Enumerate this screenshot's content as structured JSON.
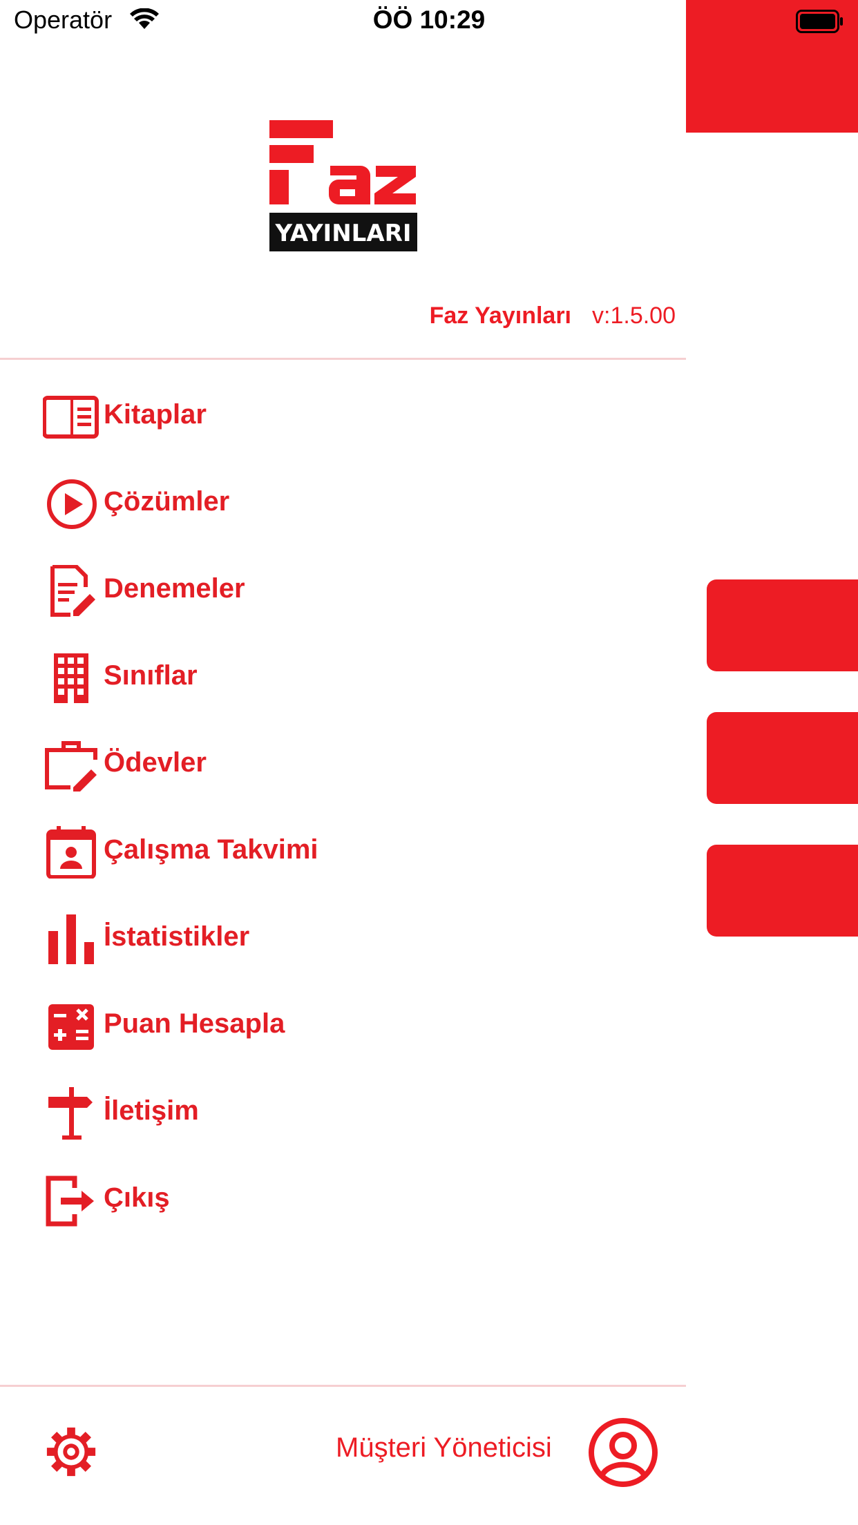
{
  "status_bar": {
    "carrier": "Operatör",
    "time": "ÖÖ 10:29"
  },
  "colors": {
    "accent": "#ed1c24",
    "logo_dark": "#111111",
    "divider": "#f6cfd1"
  },
  "logo": {
    "text": "YAYINLARI"
  },
  "drawer": {
    "brand_name": "Faz Yayınları",
    "version": "v:1.5.00",
    "items": [
      {
        "label": "Kitaplar",
        "icon": "book-icon"
      },
      {
        "label": "Çözümler",
        "icon": "play-circle-icon"
      },
      {
        "label": "Denemeler",
        "icon": "document-edit-icon"
      },
      {
        "label": "Sınıflar",
        "icon": "building-icon"
      },
      {
        "label": "Ödevler",
        "icon": "briefcase-edit-icon"
      },
      {
        "label": "Çalışma Takvimi",
        "icon": "calendar-user-icon"
      },
      {
        "label": "İstatistikler",
        "icon": "bar-chart-icon"
      },
      {
        "label": "Puan Hesapla",
        "icon": "calculator-icon"
      },
      {
        "label": "İletişim",
        "icon": "signpost-icon"
      },
      {
        "label": "Çıkış",
        "icon": "exit-icon"
      }
    ],
    "footer": {
      "settings_icon": "gear-icon",
      "user_label": "Müşteri Yöneticisi",
      "user_icon": "user-circle-icon"
    }
  },
  "background": {
    "menu_button_icon": "hamburger-icon",
    "side_buttons": 3
  }
}
